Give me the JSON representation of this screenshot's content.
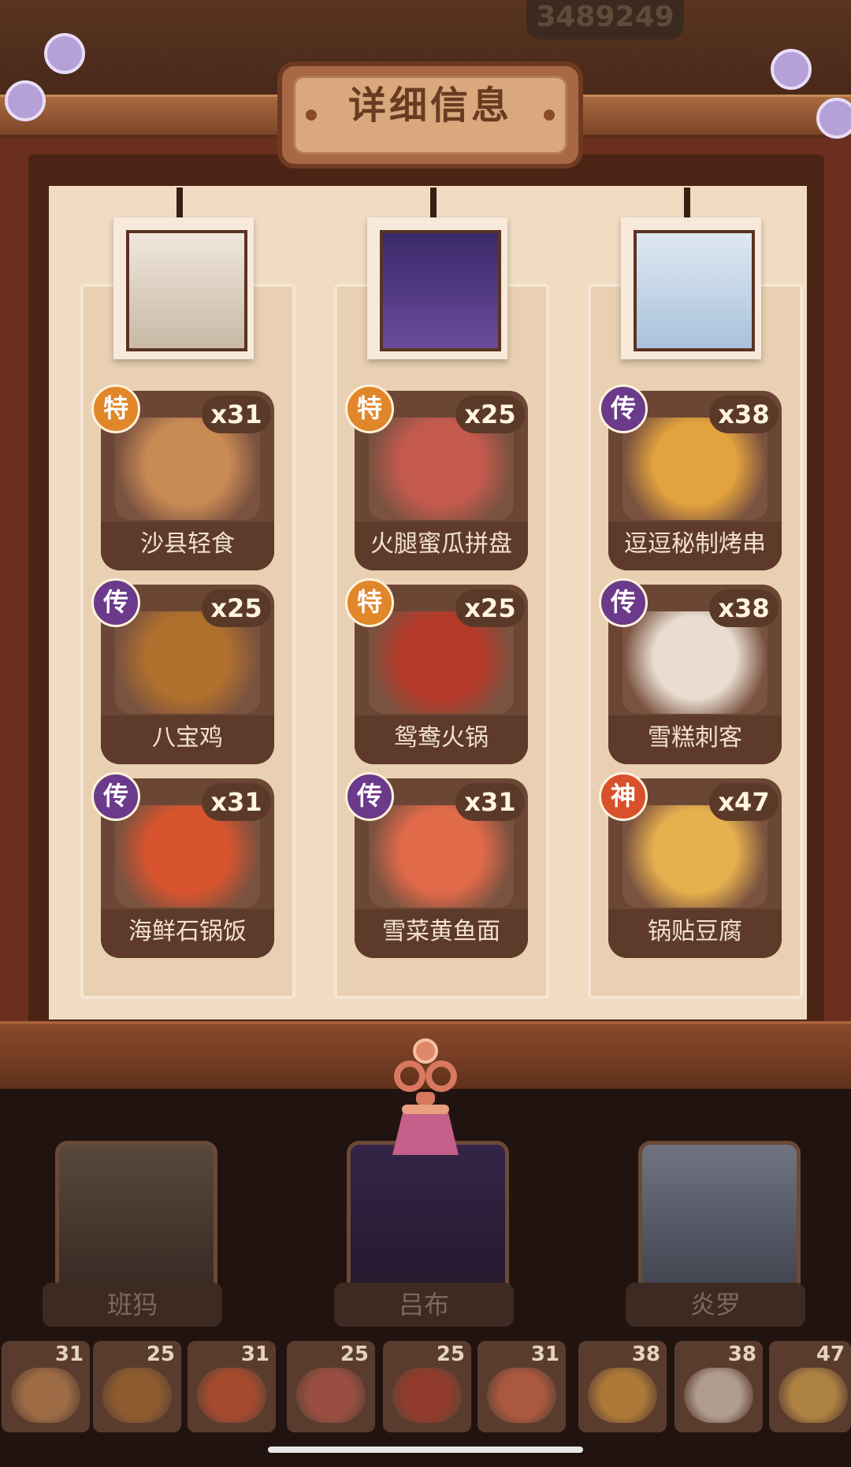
{
  "header": {
    "score": "3489249",
    "title": "详细信息"
  },
  "columns": [
    {
      "portrait_icon": "chef-portrait-icon",
      "dishes": [
        {
          "name": "沙县轻食",
          "count": "x31",
          "grade": "特",
          "grade_type": "te",
          "icon": "shaxian-snack-icon",
          "color": "#c98b54"
        },
        {
          "name": "八宝鸡",
          "count": "x25",
          "grade": "传",
          "grade_type": "chuan",
          "icon": "eight-treasure-chicken-icon",
          "color": "#b0702e"
        },
        {
          "name": "海鲜石锅饭",
          "count": "x31",
          "grade": "传",
          "grade_type": "chuan",
          "icon": "seafood-stone-pot-rice-icon",
          "color": "#d8542e"
        }
      ]
    },
    {
      "portrait_icon": "warrior-portrait-icon",
      "dishes": [
        {
          "name": "火腿蜜瓜拼盘",
          "count": "x25",
          "grade": "特",
          "grade_type": "te",
          "icon": "ham-melon-platter-icon",
          "color": "#c45a4e"
        },
        {
          "name": "鸳鸯火锅",
          "count": "x25",
          "grade": "特",
          "grade_type": "te",
          "icon": "yuanyang-hotpot-icon",
          "color": "#b63a2a"
        },
        {
          "name": "雪菜黄鱼面",
          "count": "x31",
          "grade": "传",
          "grade_type": "chuan",
          "icon": "pickled-cabbage-fish-noodle-icon",
          "color": "#e06a4a"
        }
      ]
    },
    {
      "portrait_icon": "elf-portrait-icon",
      "dishes": [
        {
          "name": "逗逗秘制烤串",
          "count": "x38",
          "grade": "传",
          "grade_type": "chuan",
          "icon": "secret-skewer-icon",
          "color": "#e2a23e"
        },
        {
          "name": "雪糕刺客",
          "count": "x38",
          "grade": "传",
          "grade_type": "chuan",
          "icon": "ice-cream-assassin-icon",
          "color": "#e8ddd0"
        },
        {
          "name": "锅贴豆腐",
          "count": "x47",
          "grade": "神",
          "grade_type": "shen",
          "icon": "pan-fried-tofu-icon",
          "color": "#e6b04e"
        }
      ]
    }
  ],
  "characters": [
    {
      "name": "班犸",
      "icon": "chef-character-icon"
    },
    {
      "name": "吕布",
      "icon": "warrior-character-icon"
    },
    {
      "name": "炎罗",
      "icon": "elf-character-icon"
    }
  ],
  "dish_strip": [
    {
      "count": "31",
      "icon": "shaxian-snack-icon",
      "color": "#c98b54"
    },
    {
      "count": "25",
      "icon": "eight-treasure-chicken-icon",
      "color": "#b0702e"
    },
    {
      "count": "31",
      "icon": "seafood-stone-pot-rice-icon",
      "color": "#d8542e"
    },
    {
      "count": "25",
      "icon": "ham-melon-platter-icon",
      "color": "#c45a4e"
    },
    {
      "count": "25",
      "icon": "yuanyang-hotpot-icon",
      "color": "#b63a2a"
    },
    {
      "count": "31",
      "icon": "pickled-cabbage-fish-noodle-icon",
      "color": "#e06a4a"
    },
    {
      "count": "38",
      "icon": "secret-skewer-icon",
      "color": "#e2a23e"
    },
    {
      "count": "38",
      "icon": "ice-cream-assassin-icon",
      "color": "#e8ddd0"
    },
    {
      "count": "47",
      "icon": "pan-fried-tofu-icon",
      "color": "#e6b04e"
    }
  ]
}
